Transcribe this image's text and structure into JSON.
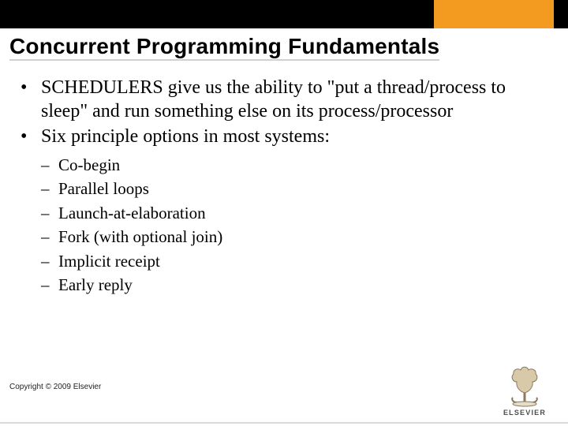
{
  "colors": {
    "accent": "#f39b21",
    "topbar": "#000000",
    "logo_primary": "#f39b21",
    "logo_text": "#4c4c4c"
  },
  "title": "Concurrent Programming Fundamentals",
  "bullets": [
    "SCHEDULERS give us the ability to \"put a thread/process to sleep\" and run something else on its process/processor",
    "Six principle options in most systems:"
  ],
  "subbullets": [
    "Co-begin",
    "Parallel loops",
    "Launch-at-elaboration",
    "Fork (with optional join)",
    "Implicit receipt",
    "Early reply"
  ],
  "footer": "Copyright © 2009 Elsevier",
  "logo_label": "ELSEVIER"
}
